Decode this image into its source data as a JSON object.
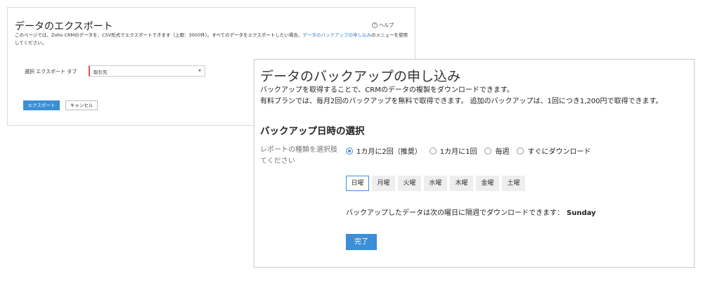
{
  "export_page": {
    "title": "データのエクスポート",
    "help_label": "ヘルプ",
    "description_prefix": "このページでは、Zoho CRMのデータを、CSV形式でエクスポートできます（上限：3000件）。すべてのデータをエクスポートしたい場合、",
    "description_link": "データのバックアップの申し込み",
    "description_suffix": "のメニューを使用してください。",
    "type_label": "選択 エクスポート タブ",
    "type_value": "取引先",
    "export_button": "エクスポート",
    "cancel_button": "キャンセル"
  },
  "backup_page": {
    "title": "データのバックアップの申し込み",
    "desc_line1": "バックアップを取得することで、CRMのデータの複製をダウンロードできます。",
    "desc_line2": "有料プランでは、毎月2回のバックアップを無料で取得できます。 追加のバックアップは、1回につき1,200円で取得できます。",
    "section_title": "バックアップ日時の選択",
    "report_label": "レポートの種類を選択肢てください",
    "radio_options": [
      {
        "label": "1カ月に2回（推奨）",
        "checked": true
      },
      {
        "label": "1カ月に1回",
        "checked": false
      },
      {
        "label": "毎週",
        "checked": false
      },
      {
        "label": "すぐにダウンロード",
        "checked": false
      }
    ],
    "days": [
      {
        "label": "日曜",
        "active": true
      },
      {
        "label": "月曜",
        "active": false
      },
      {
        "label": "火曜",
        "active": false
      },
      {
        "label": "水曜",
        "active": false
      },
      {
        "label": "木曜",
        "active": false
      },
      {
        "label": "金曜",
        "active": false
      },
      {
        "label": "土曜",
        "active": false
      }
    ],
    "note": "バックアップしたデータは次の曜日に隔週でダウンロードできます：",
    "note_day": "Sunday",
    "done_button": "完了"
  },
  "colors": {
    "accent": "#3a8fd6",
    "required": "#d9534f",
    "link": "#2c7cc6"
  },
  "icons": {
    "help": "help-icon",
    "select_caret": "chevron-down-icon"
  }
}
